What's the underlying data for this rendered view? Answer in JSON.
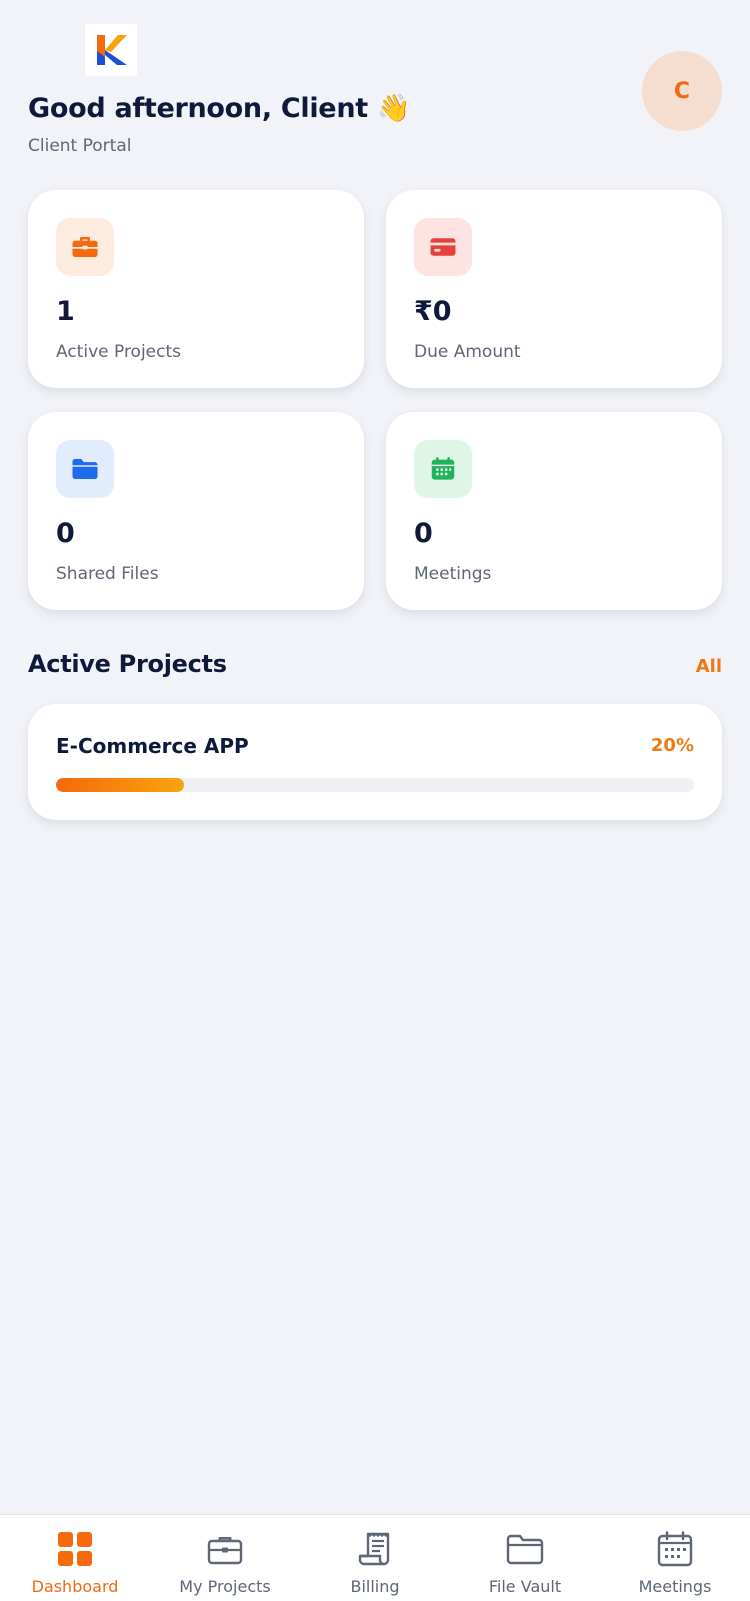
{
  "header": {
    "greeting": "Good afternoon, Client 👋",
    "subtitle": "Client Portal",
    "avatar_initial": "C"
  },
  "stats": [
    {
      "value": "1",
      "label": "Active Projects",
      "icon": "briefcase-icon",
      "color": "#f46a0c",
      "bg": "#fdebe0"
    },
    {
      "value": "₹0",
      "label": "Due Amount",
      "icon": "credit-card-icon",
      "color": "#e5403a",
      "bg": "#fde3e2"
    },
    {
      "value": "0",
      "label": "Shared Files",
      "icon": "folder-icon",
      "color": "#1f6bf0",
      "bg": "#e1ecfd"
    },
    {
      "value": "0",
      "label": "Meetings",
      "icon": "calendar-icon",
      "color": "#22b15d",
      "bg": "#dff5e8"
    }
  ],
  "active_projects": {
    "title": "Active Projects",
    "link_label": "All",
    "projects": [
      {
        "name": "E-Commerce APP",
        "progress_label": "20%",
        "progress": 20
      }
    ]
  },
  "bottom_nav": {
    "items": [
      {
        "label": "Dashboard",
        "icon": "dashboard-grid-icon",
        "active": true
      },
      {
        "label": "My Projects",
        "icon": "briefcase-icon",
        "active": false
      },
      {
        "label": "Billing",
        "icon": "receipt-icon",
        "active": false
      },
      {
        "label": "File Vault",
        "icon": "folder-icon",
        "active": false
      },
      {
        "label": "Meetings",
        "icon": "calendar-icon",
        "active": false
      }
    ]
  },
  "colors": {
    "accent": "#ef7a12",
    "background": "#f1f3f8",
    "text_dark": "#0f1a3a",
    "text_muted": "#5f6678"
  }
}
